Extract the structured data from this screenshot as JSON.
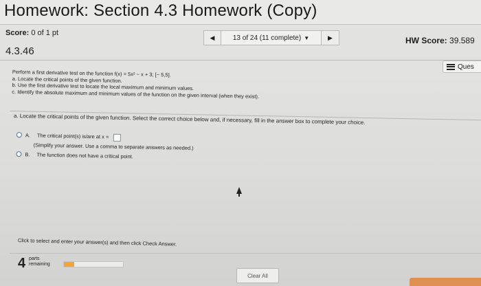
{
  "title": "Homework: Section 4.3 Homework (Copy)",
  "score": {
    "label": "Score:",
    "value": "0 of 1 pt"
  },
  "question_id": "4.3.46",
  "nav": {
    "prev_icon": "triangle-left-icon",
    "position_text": "13 of 24 (11 complete)",
    "dropdown_icon": "triangle-down-icon",
    "next_icon": "triangle-right-icon"
  },
  "hw_score": {
    "label": "HW Score:",
    "value": "39.589"
  },
  "question_menu_label": "Ques",
  "problem": {
    "intro": "Perform a first derivative test on the function f(x) = 5x² − x + 3; [− 5,5].",
    "part_a": "a. Locate the critical points of the given function.",
    "part_b": "b. Use the first derivative test to locate the local maximum and minimum values.",
    "part_c": "c. Identify the absolute maximum and minimum values of the function on the given interval (when they exist)."
  },
  "question": "a. Locate the critical points of the given function. Select the correct choice below and, if necessary, fill in the answer box to complete your choice.",
  "choices": [
    {
      "letter": "A.",
      "text": "The critical point(s) is/are at x =",
      "hint_line1": "(Simplify your answer. Use a comma to separate answers as needed.)"
    },
    {
      "letter": "B.",
      "text": "The function does not have a critical point."
    }
  ],
  "instruction": "Click to select and enter your answer(s) and then click Check Answer.",
  "parts": {
    "count": "4",
    "label_line1": "parts",
    "label_line2": "remaining",
    "progress_fraction": 0.18
  },
  "clear_all_label": "Clear All",
  "colors": {
    "progress": "#f2a33a",
    "check_button": "#e08f53",
    "radio_border": "#4a6f9a"
  }
}
